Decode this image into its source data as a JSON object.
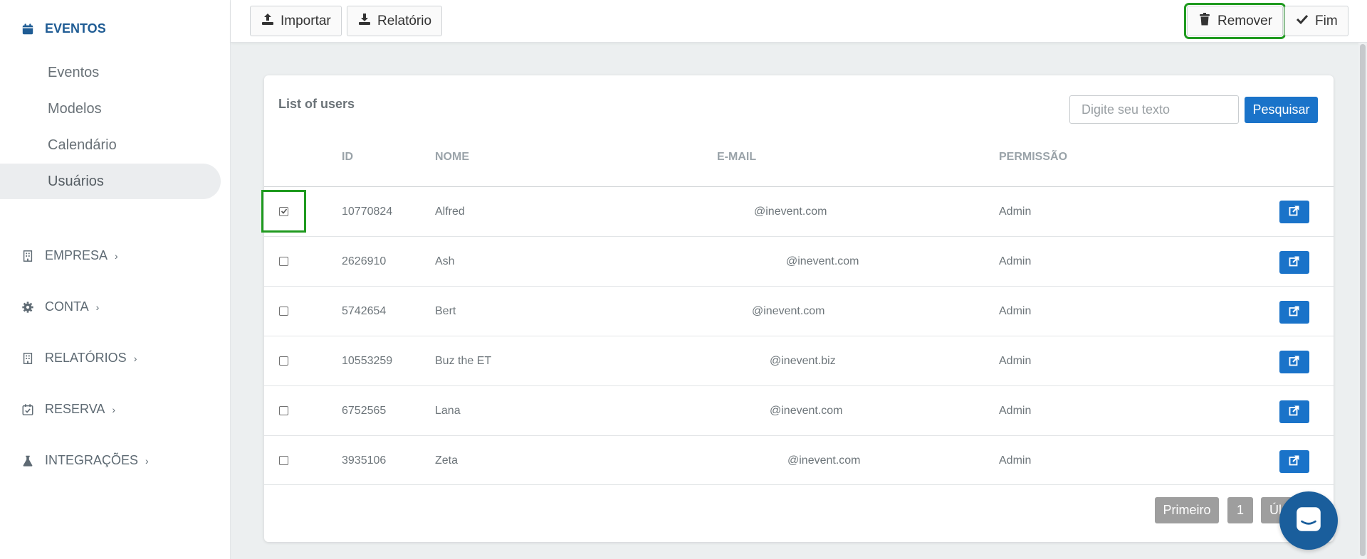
{
  "sidebar": {
    "eventos": {
      "label": "EVENTOS",
      "items": [
        {
          "label": "Eventos"
        },
        {
          "label": "Modelos"
        },
        {
          "label": "Calendário"
        },
        {
          "label": "Usuários"
        }
      ]
    },
    "sections": [
      {
        "label": "EMPRESA",
        "icon": "building-icon"
      },
      {
        "label": "CONTA",
        "icon": "gear-icon"
      },
      {
        "label": "RELATÓRIOS",
        "icon": "building-icon"
      },
      {
        "label": "RESERVA",
        "icon": "calendar-check-icon"
      },
      {
        "label": "INTEGRAÇÕES",
        "icon": "flask-icon"
      }
    ]
  },
  "toolbar": {
    "import_label": "Importar",
    "report_label": "Relatório",
    "remove_label": "Remover",
    "finish_label": "Fim"
  },
  "card": {
    "title": "List of users",
    "search": {
      "placeholder": "Digite seu texto",
      "button_label": "Pesquisar"
    },
    "columns": {
      "id": "ID",
      "name": "NOME",
      "email": "E-MAIL",
      "permission": "PERMISSÃO"
    },
    "rows": [
      {
        "id": "10770824",
        "name": "Alfred",
        "email": "@inevent.com",
        "permission": "Admin",
        "checked": true
      },
      {
        "id": "2626910",
        "name": "Ash",
        "email": "@inevent.com",
        "permission": "Admin",
        "checked": false
      },
      {
        "id": "5742654",
        "name": "Bert",
        "email": "@inevent.com",
        "permission": "Admin",
        "checked": false
      },
      {
        "id": "10553259",
        "name": "Buz the ET",
        "email": "@inevent.biz",
        "permission": "Admin",
        "checked": false
      },
      {
        "id": "6752565",
        "name": "Lana",
        "email": "@inevent.com",
        "permission": "Admin",
        "checked": false
      },
      {
        "id": "3935106",
        "name": "Zeta",
        "email": "@inevent.com",
        "permission": "Admin",
        "checked": false
      }
    ],
    "pagination": {
      "first_label": "Primeiro",
      "page": "1",
      "last_label": "Úl"
    }
  },
  "colors": {
    "accent": "#1a73c9",
    "nav_active": "#1f5c94",
    "highlight": "#1f9a1f"
  }
}
